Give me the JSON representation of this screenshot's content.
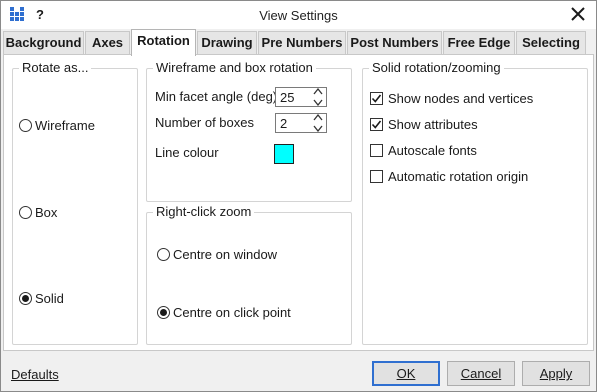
{
  "window": {
    "title": "View Settings",
    "help": "?"
  },
  "tabs": [
    {
      "label": "Background"
    },
    {
      "label": "Axes"
    },
    {
      "label": "Rotation"
    },
    {
      "label": "Drawing"
    },
    {
      "label": "Pre Numbers"
    },
    {
      "label": "Post Numbers"
    },
    {
      "label": "Free Edge"
    },
    {
      "label": "Selecting"
    }
  ],
  "active_tab": "Rotation",
  "rotate_as": {
    "title": "Rotate as...",
    "options": [
      {
        "label": "Wireframe",
        "selected": false
      },
      {
        "label": "Box",
        "selected": false
      },
      {
        "label": "Solid",
        "selected": true
      }
    ]
  },
  "wireframe_box": {
    "title": "Wireframe and box rotation",
    "min_facet_label": "Min facet angle (deg)",
    "min_facet_value": "25",
    "num_boxes_label": "Number of boxes",
    "num_boxes_value": "2",
    "line_colour_label": "Line colour",
    "line_colour": "#00ffff"
  },
  "right_click_zoom": {
    "title": "Right-click zoom",
    "options": [
      {
        "label": "Centre on window",
        "selected": false
      },
      {
        "label": "Centre on click point",
        "selected": true
      }
    ]
  },
  "solid_rotation": {
    "title": "Solid rotation/zooming",
    "options": [
      {
        "label": "Show nodes and vertices",
        "checked": true
      },
      {
        "label": "Show attributes",
        "checked": true
      },
      {
        "label": "Autoscale fonts",
        "checked": false
      },
      {
        "label": "Automatic rotation origin",
        "checked": false
      }
    ]
  },
  "footer": {
    "defaults_link": "Defaults",
    "ok_label": "OK",
    "cancel_label": "Cancel",
    "apply_label": "Apply"
  },
  "colors": {
    "accent": "#2f6fd0",
    "swatch": "#00ffff"
  }
}
